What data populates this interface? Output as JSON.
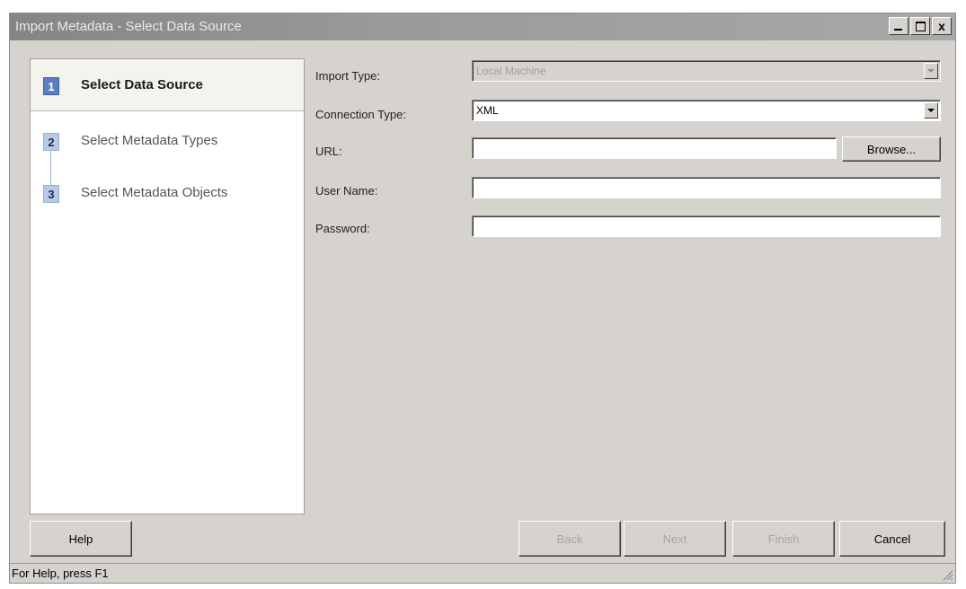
{
  "window": {
    "title": "Import Metadata - Select Data Source",
    "minimize_label": "_",
    "close_label": "x"
  },
  "steps": [
    {
      "number": "1",
      "label": "Select Data Source",
      "active": true
    },
    {
      "number": "2",
      "label": "Select Metadata Types",
      "active": false
    },
    {
      "number": "3",
      "label": "Select Metadata Objects",
      "active": false
    }
  ],
  "form": {
    "import_type": {
      "label": "Import Type:",
      "value": "Local Machine",
      "enabled": false
    },
    "connection_type": {
      "label": "Connection Type:",
      "value": "XML"
    },
    "url": {
      "label": "URL:",
      "value": "",
      "browse_label": "Browse..."
    },
    "user_name": {
      "label": "User Name:",
      "value": ""
    },
    "password": {
      "label": "Password:",
      "value": ""
    }
  },
  "buttons": {
    "help": "Help",
    "back": "Back",
    "next": "Next",
    "finish": "Finish",
    "cancel": "Cancel"
  },
  "status": {
    "text": "For Help, press F1"
  },
  "colors": {
    "active_step_number": "#5a7fc2",
    "inactive_step_number": "#b8cbe6",
    "dialog_background": "#d6d3ce"
  }
}
